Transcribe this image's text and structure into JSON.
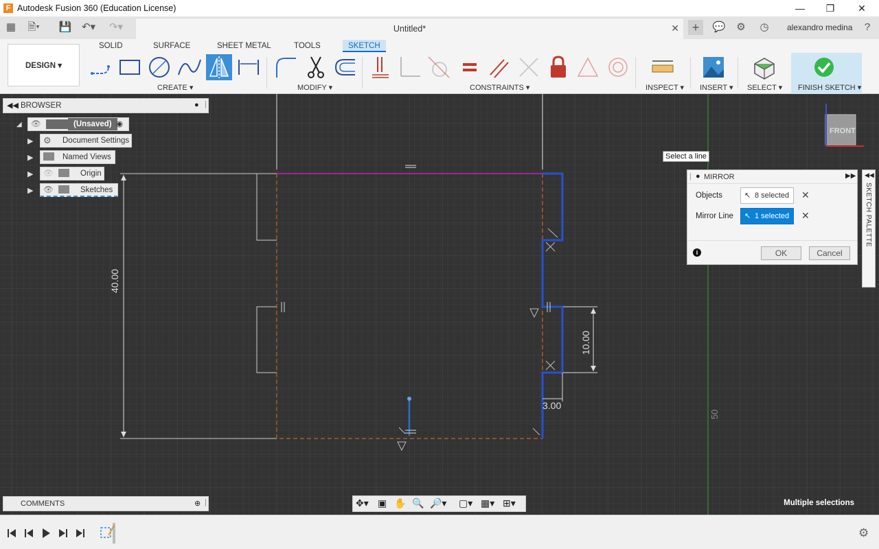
{
  "app": {
    "title": "Autodesk Fusion 360 (Education License)",
    "icon_letter": "F"
  },
  "tabbar": {
    "doc_title": "Untitled*",
    "username": "alexandro medina"
  },
  "toolbar": {
    "design_label": "DESIGN",
    "workspace_tabs": [
      "SOLID",
      "SURFACE",
      "SHEET METAL",
      "TOOLS",
      "SKETCH"
    ],
    "active_tab": "SKETCH",
    "groups": {
      "create": "CREATE",
      "modify": "MODIFY",
      "constraints": "CONSTRAINTS",
      "inspect": "INSPECT",
      "insert": "INSERT",
      "select": "SELECT",
      "finish": "FINISH SKETCH"
    }
  },
  "browser": {
    "header": "BROWSER",
    "root": "(Unsaved)",
    "items": [
      "Document Settings",
      "Named Views",
      "Origin",
      "Sketches"
    ]
  },
  "mirror_dialog": {
    "title": "MIRROR",
    "objects_label": "Objects",
    "objects_value": "8 selected",
    "mirror_line_label": "Mirror Line",
    "mirror_line_value": "1 selected",
    "ok": "OK",
    "cancel": "Cancel"
  },
  "tooltip": "Select a line",
  "sketch_palette": "SKETCH PALETTE",
  "view_cube": "FRONT",
  "canvas": {
    "dimensions": {
      "height": "40.00",
      "notch": "10.00",
      "depth": "3.00"
    },
    "grid_label": "50"
  },
  "comments": "COMMENTS",
  "status": "Multiple selections",
  "colors": {
    "accent": "#0a82d8",
    "sketch_selected": "#2a4fd1",
    "construction": "#c06030",
    "mirror_line": "#c020c0",
    "finish": "#35b94a"
  }
}
